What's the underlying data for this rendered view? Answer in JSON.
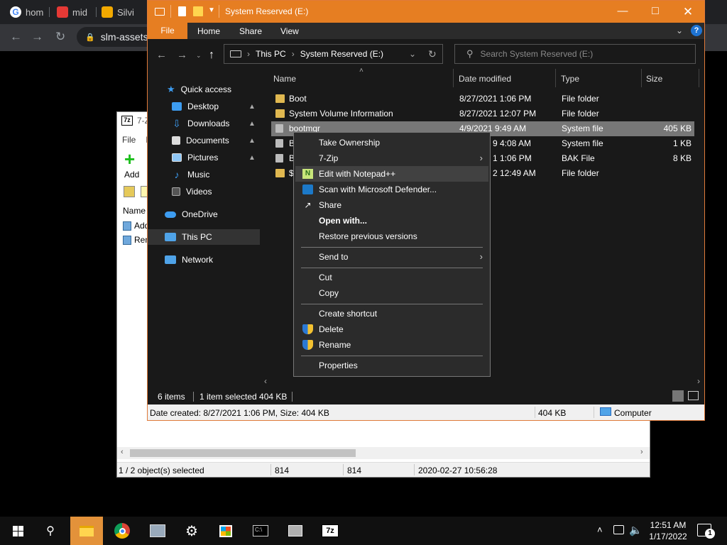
{
  "browser": {
    "tabs": [
      {
        "label": "hom",
        "color": "#ffffff"
      },
      {
        "label": "mid",
        "color": "#e53935"
      },
      {
        "label": "Silvi",
        "color": "#f2a900"
      }
    ],
    "omnibox_text": "slm-assets"
  },
  "sevenzip": {
    "title": "7-Z",
    "logo": "7z",
    "menu": [
      "File",
      "E"
    ],
    "toolbar_add": "Add",
    "col_name": "Name",
    "rows": [
      "Add",
      "Ren"
    ],
    "status": {
      "selected": "1 / 2 object(s) selected",
      "size": "814",
      "packed": "814",
      "date": "2020-02-27 10:56:28"
    }
  },
  "explorer": {
    "title": "System Reserved (E:)",
    "ribbon": {
      "file": "File",
      "home": "Home",
      "share": "Share",
      "view": "View"
    },
    "address": {
      "this_pc": "This PC",
      "drive": "System Reserved (E:)"
    },
    "search_placeholder": "Search System Reserved (E:)",
    "nav": {
      "quick_access": "Quick access",
      "desktop": "Desktop",
      "downloads": "Downloads",
      "documents": "Documents",
      "pictures": "Pictures",
      "music": "Music",
      "videos": "Videos",
      "onedrive": "OneDrive",
      "this_pc": "This PC",
      "network": "Network"
    },
    "columns": {
      "name": "Name",
      "date": "Date modified",
      "type": "Type",
      "size": "Size"
    },
    "files": [
      {
        "name": "Boot",
        "date": "8/27/2021 1:06 PM",
        "type": "File folder",
        "size": ""
      },
      {
        "name": "System Volume Information",
        "date": "8/27/2021 12:07 PM",
        "type": "File folder",
        "size": ""
      },
      {
        "name": "bootmgr",
        "date": "4/9/2021 9:49 AM",
        "type": "System file",
        "size": "405 KB"
      },
      {
        "name": "B",
        "date": "9 4:08 AM",
        "type": "System file",
        "size": "1 KB"
      },
      {
        "name": "B",
        "date": "1 1:06 PM",
        "type": "BAK File",
        "size": "8 KB"
      },
      {
        "name": "$",
        "date": "2 12:49 AM",
        "type": "File folder",
        "size": ""
      }
    ],
    "status": {
      "items": "6 items",
      "selected": "1 item selected  404 KB"
    },
    "details": {
      "created": "Date created: 8/27/2021 1:06 PM, Size: 404 KB",
      "size": "404 KB",
      "location": "Computer"
    }
  },
  "context_menu": {
    "take_ownership": "Take Ownership",
    "seven_zip": "7-Zip",
    "edit_notepad": "Edit with Notepad++",
    "scan_defender": "Scan with Microsoft Defender...",
    "share": "Share",
    "open_with": "Open with...",
    "restore": "Restore previous versions",
    "send_to": "Send to",
    "cut": "Cut",
    "copy": "Copy",
    "create_shortcut": "Create shortcut",
    "delete": "Delete",
    "rename": "Rename",
    "properties": "Properties"
  },
  "taskbar": {
    "time": "12:51 AM",
    "date": "1/17/2022",
    "notification_count": "1",
    "sevenzip_label": "7z"
  },
  "colors": {
    "accent": "#e67e22",
    "taskbar_active": "#e3923a"
  }
}
